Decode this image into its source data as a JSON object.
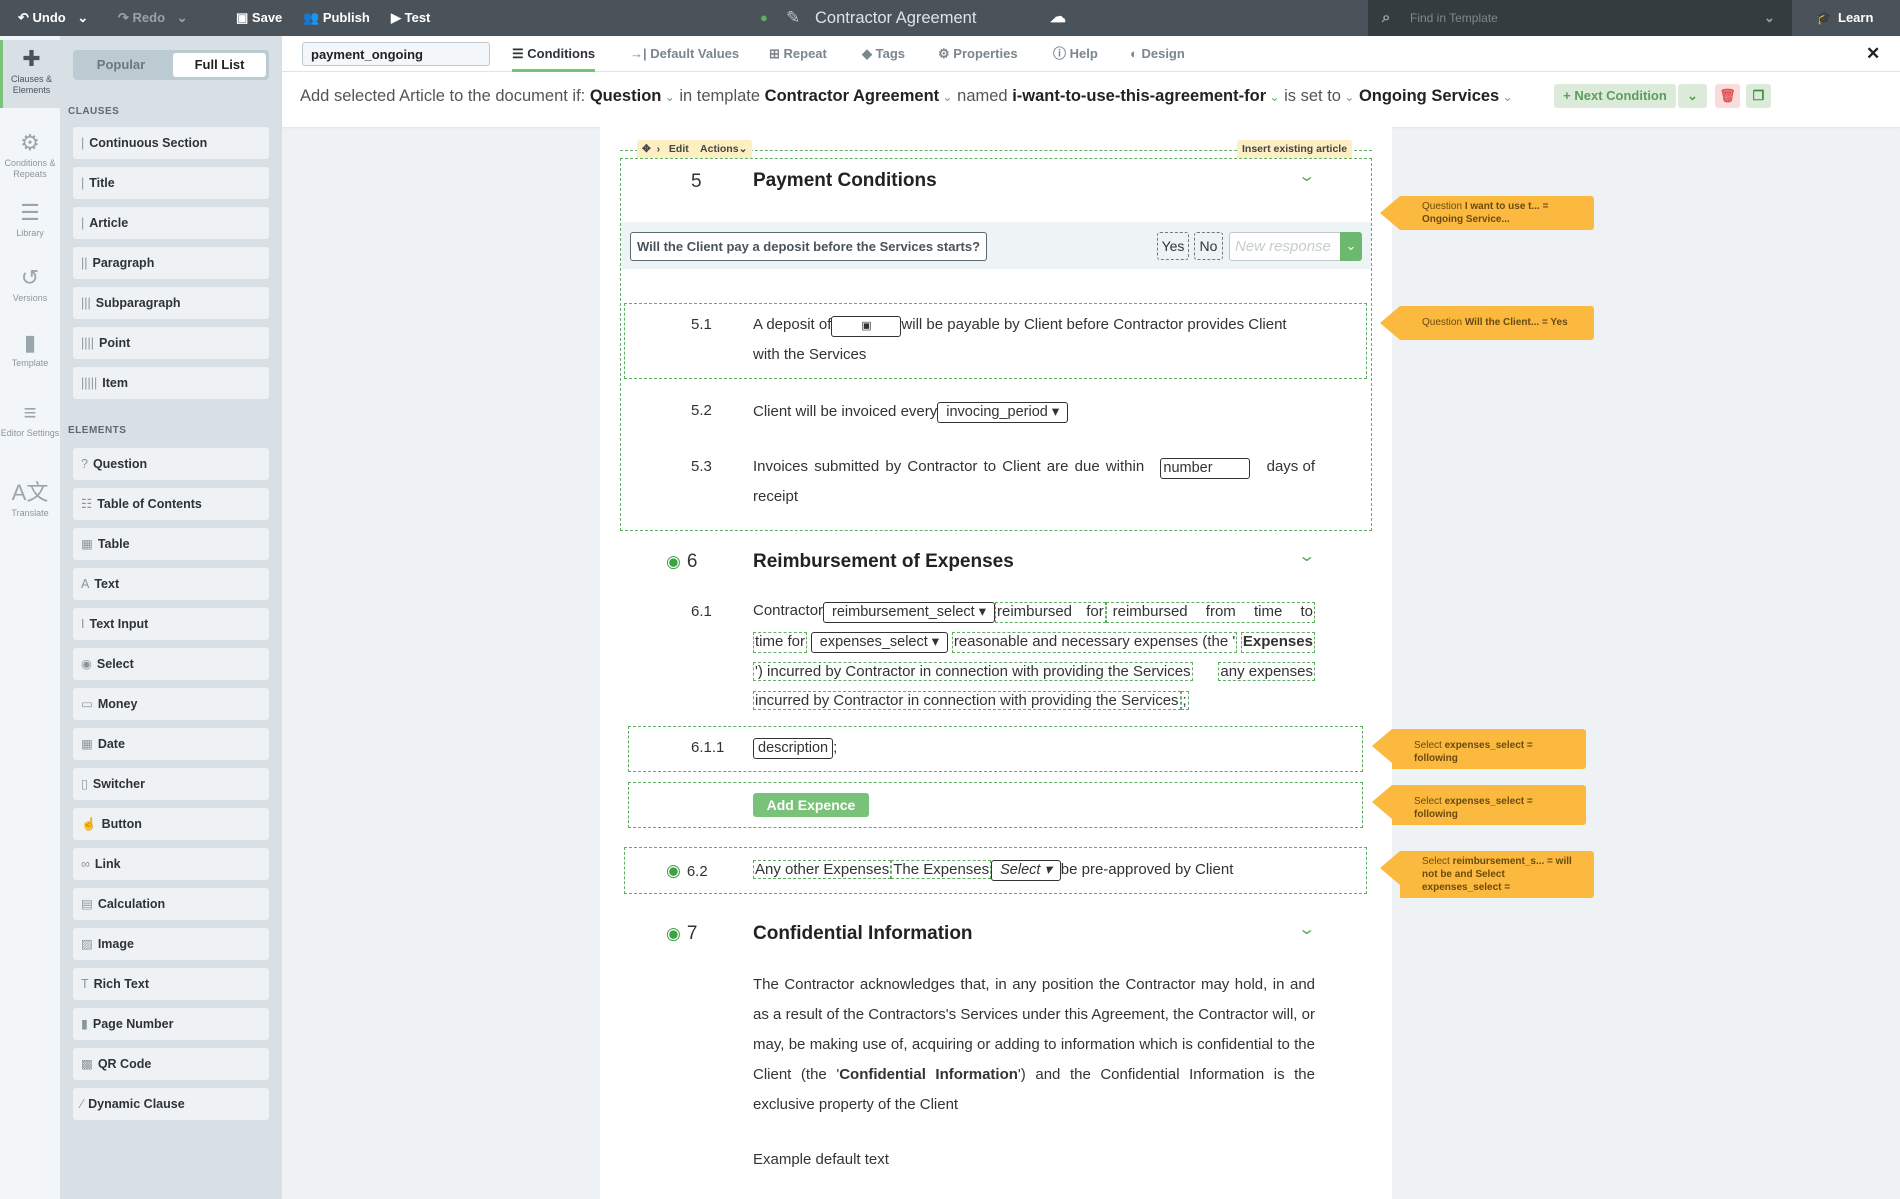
{
  "topbar": {
    "undo": "Undo",
    "redo": "Redo",
    "save": "Save",
    "publish": "Publish",
    "test": "Test",
    "title": "Contractor Agreement",
    "search_placeholder": "Find in Template",
    "learn": "Learn"
  },
  "rail": [
    {
      "label": "Clauses & Elements",
      "icon": "puzzle-icon",
      "glyph": "✚",
      "active": true
    },
    {
      "label": "Conditions & Repeats",
      "icon": "gears-icon",
      "glyph": "⚙"
    },
    {
      "label": "Library",
      "icon": "library-icon",
      "glyph": "☰"
    },
    {
      "label": "Versions",
      "icon": "history-icon",
      "glyph": "↺"
    },
    {
      "label": "Template",
      "icon": "file-icon",
      "glyph": "▮"
    },
    {
      "label": "Editor Settings",
      "icon": "sliders-icon",
      "glyph": "≡"
    },
    {
      "label": "Translate",
      "icon": "translate-icon",
      "glyph": "A文"
    }
  ],
  "panel": {
    "tabs": {
      "popular": "Popular",
      "full_list": "Full List"
    },
    "clauses_header": "CLAUSES",
    "clauses": [
      {
        "label": "Continuous Section",
        "glyph": "|"
      },
      {
        "label": "Title",
        "glyph": "|"
      },
      {
        "label": "Article",
        "glyph": "|"
      },
      {
        "label": "Paragraph",
        "glyph": "||"
      },
      {
        "label": "Subparagraph",
        "glyph": "|||"
      },
      {
        "label": "Point",
        "glyph": "||||"
      },
      {
        "label": "Item",
        "glyph": "|||||"
      }
    ],
    "elements_header": "ELEMENTS",
    "elements": [
      {
        "label": "Question",
        "glyph": "?"
      },
      {
        "label": "Table of Contents",
        "glyph": "☷"
      },
      {
        "label": "Table",
        "glyph": "▦"
      },
      {
        "label": "Text",
        "glyph": "A"
      },
      {
        "label": "Text Input",
        "glyph": "I"
      },
      {
        "label": "Select",
        "glyph": "◉"
      },
      {
        "label": "Money",
        "glyph": "▭"
      },
      {
        "label": "Date",
        "glyph": "▦"
      },
      {
        "label": "Switcher",
        "glyph": "▯"
      },
      {
        "label": "Button",
        "glyph": "☝"
      },
      {
        "label": "Link",
        "glyph": "∞"
      },
      {
        "label": "Calculation",
        "glyph": "▤"
      },
      {
        "label": "Image",
        "glyph": "▨"
      },
      {
        "label": "Rich Text",
        "glyph": "T"
      },
      {
        "label": "Page Number",
        "glyph": "▮"
      },
      {
        "label": "QR Code",
        "glyph": "▩"
      },
      {
        "label": "Dynamic Clause",
        "glyph": "⁄"
      }
    ]
  },
  "tabs": {
    "name_value": "payment_ongoing",
    "items": [
      "Conditions",
      "Default Values",
      "Repeat",
      "Tags",
      "Properties",
      "Help",
      "Design"
    ],
    "active": "Conditions"
  },
  "condition": {
    "prefix": "Add selected Article to the document if:",
    "type": "Question",
    "in_template": "in template",
    "template": "Contractor Agreement",
    "named": "named",
    "name": "i-want-to-use-this-agreement-for",
    "is_set_to": "is set to",
    "value": "Ongoing Services",
    "next_condition": "+ Next Condition"
  },
  "doc": {
    "toolbar": {
      "edit": "Edit",
      "actions": "Actions",
      "insert": "Insert existing article"
    },
    "s5": {
      "num": "5",
      "title": "Payment Conditions"
    },
    "question": {
      "text": "Will the Client pay a deposit before the Services starts?",
      "yes": "Yes",
      "no": "No",
      "new_placeholder": "New response"
    },
    "s51": {
      "num": "5.1",
      "a": "A deposit of",
      "b": "will be payable by Client before Contractor provides Client",
      "c": "with the Services"
    },
    "s52": {
      "num": "5.2",
      "a": "Client will be invoiced every",
      "field": "invocing_period"
    },
    "s53": {
      "num": "5.3",
      "a": "Invoices submitted by Contractor to Client are due within",
      "field": "number",
      "b": "days of",
      "c": "receipt"
    },
    "s6": {
      "num": "6",
      "title": "Reimbursement of Expenses"
    },
    "s61": {
      "num": "6.1",
      "a": "Contractor",
      "field1": "reimbursement_select",
      "b": "reimbursed for",
      "c": "reimbursed from time to",
      "d": "time for",
      "field2": "expenses_select",
      "e": "reasonable and necessary expenses (the '",
      "f": "Expenses",
      "g": "') incurred by Contractor in connection with providing the Services",
      "h": "any expenses",
      "i": "incurred by Contractor in connection with providing the Services",
      "j": ";"
    },
    "s611": {
      "num": "6.1.1",
      "field": "description",
      "end": ";"
    },
    "add_expence": "Add Expence",
    "s62": {
      "num": "6.2",
      "a": "Any other Expenses",
      "b": "The Expenses",
      "field": "Select",
      "c": "be pre-approved by Client"
    },
    "s7": {
      "num": "7",
      "title": "Confidential Information"
    },
    "s7p": {
      "a": "The Contractor acknowledges that, in any position the Contractor may hold, in and as a result of the Contractors's Services under this Agreement, the Contractor will, or may, be making use of, acquiring or adding to information which is confidential to the Client (the '",
      "b": "Confidential Information",
      "c": "') and the Confidential Information is the exclusive property of the Client"
    },
    "example": "Example default text"
  },
  "callouts": [
    {
      "pre": "Question ",
      "bold": "I want to use t... = Ongoing Service..."
    },
    {
      "pre": "Question ",
      "bold": "Will the Client... = Yes"
    },
    {
      "pre": "Select ",
      "bold": "expenses_select = following"
    },
    {
      "pre": "Select ",
      "bold": "expenses_select = following"
    },
    {
      "pre": "Select ",
      "bold": "reimbursement_s... = will not be and Select expenses_select ="
    }
  ],
  "colors": {
    "accent": "#79c27a",
    "topbar": "#4a5359",
    "callout": "#fbb93f",
    "danger": "#e05555"
  }
}
